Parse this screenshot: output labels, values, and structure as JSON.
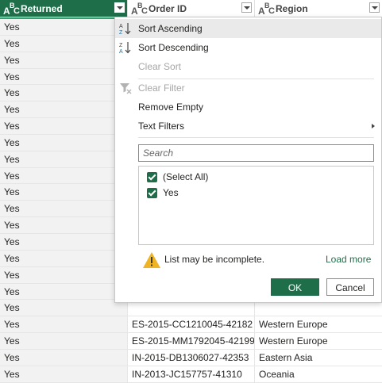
{
  "columns": [
    {
      "name": "Returned",
      "type_icon": "text-type-icon"
    },
    {
      "name": "Order ID",
      "type_icon": "text-type-icon"
    },
    {
      "name": "Region",
      "type_icon": "text-type-icon"
    }
  ],
  "type_icon_text": {
    "a": "A",
    "b": "B",
    "c": "C"
  },
  "rows": [
    {
      "returned": "Yes",
      "order_id": "",
      "region": ""
    },
    {
      "returned": "Yes",
      "order_id": "",
      "region": ""
    },
    {
      "returned": "Yes",
      "order_id": "",
      "region": ""
    },
    {
      "returned": "Yes",
      "order_id": "",
      "region": ""
    },
    {
      "returned": "Yes",
      "order_id": "",
      "region": ""
    },
    {
      "returned": "Yes",
      "order_id": "",
      "region": ""
    },
    {
      "returned": "Yes",
      "order_id": "",
      "region": ""
    },
    {
      "returned": "Yes",
      "order_id": "",
      "region": ""
    },
    {
      "returned": "Yes",
      "order_id": "",
      "region": ""
    },
    {
      "returned": "Yes",
      "order_id": "",
      "region": ""
    },
    {
      "returned": "Yes",
      "order_id": "",
      "region": ""
    },
    {
      "returned": "Yes",
      "order_id": "",
      "region": ""
    },
    {
      "returned": "Yes",
      "order_id": "",
      "region": ""
    },
    {
      "returned": "Yes",
      "order_id": "",
      "region": ""
    },
    {
      "returned": "Yes",
      "order_id": "",
      "region": ""
    },
    {
      "returned": "Yes",
      "order_id": "",
      "region": ""
    },
    {
      "returned": "Yes",
      "order_id": "",
      "region": ""
    },
    {
      "returned": "Yes",
      "order_id": "",
      "region": ""
    },
    {
      "returned": "Yes",
      "order_id": "ES-2015-CC1210045-42182",
      "region": "Western Europe"
    },
    {
      "returned": "Yes",
      "order_id": "ES-2015-MM1792045-42199",
      "region": "Western Europe"
    },
    {
      "returned": "Yes",
      "order_id": "IN-2015-DB1306027-42353",
      "region": "Eastern Asia"
    },
    {
      "returned": "Yes",
      "order_id": "IN-2013-JC157757-41310",
      "region": "Oceania"
    }
  ],
  "menu": {
    "sort_ascending": "Sort Ascending",
    "sort_descending": "Sort Descending",
    "clear_sort": "Clear Sort",
    "clear_filter": "Clear Filter",
    "remove_empty": "Remove Empty",
    "text_filters": "Text Filters",
    "search_placeholder": "Search",
    "values": [
      {
        "label": "(Select All)",
        "checked": true
      },
      {
        "label": "Yes",
        "checked": true
      }
    ],
    "warning": "List may be incomplete.",
    "load_more": "Load more",
    "ok": "OK",
    "cancel": "Cancel"
  },
  "colors": {
    "accent": "#1f6e4a",
    "warning": "#f0b323"
  }
}
